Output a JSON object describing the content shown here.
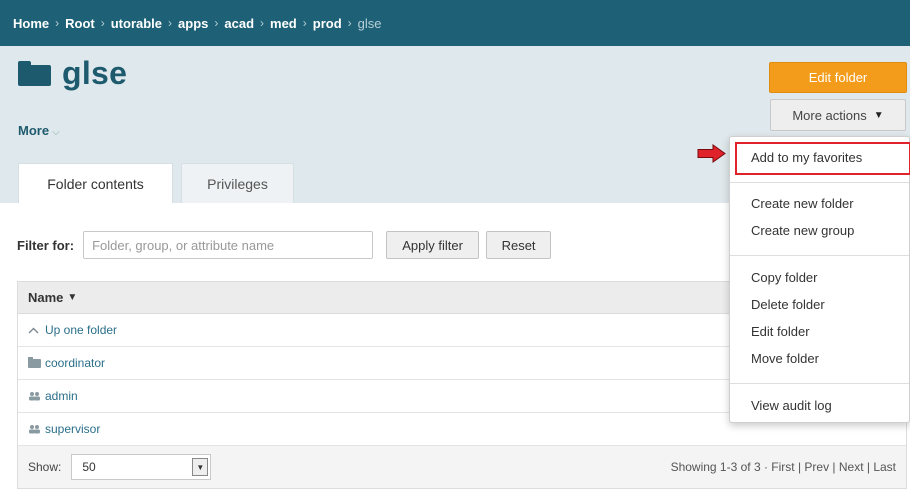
{
  "breadcrumb": {
    "items": [
      "Home",
      "Root",
      "utorable",
      "apps",
      "acad",
      "med",
      "prod"
    ],
    "current": "glse",
    "separator": "›"
  },
  "folder": {
    "title": "glse",
    "more_label": "More",
    "more_chevron": "⌵"
  },
  "actions": {
    "edit_folder": "Edit folder",
    "more_actions": "More actions",
    "more_caret": "▼"
  },
  "tabs": [
    {
      "label": "Folder contents",
      "active": true
    },
    {
      "label": "Privileges",
      "active": false
    }
  ],
  "filter": {
    "label": "Filter for:",
    "placeholder": "Folder, group, or attribute name",
    "apply": "Apply filter",
    "reset": "Reset"
  },
  "table": {
    "header": "Name",
    "sort_caret": "▼",
    "rows": [
      {
        "label": "Up one folder",
        "icon": "chevron-up-icon",
        "glyph": "^"
      },
      {
        "label": "coordinator",
        "icon": "folder-icon",
        "glyph": ""
      },
      {
        "label": "admin",
        "icon": "group-icon",
        "glyph": "👥"
      },
      {
        "label": "supervisor",
        "icon": "group-icon",
        "glyph": "👥"
      }
    ],
    "footer": {
      "show_label": "Show:",
      "page_size": "50",
      "paging": "Showing 1-3 of 3 · First | Prev | Next | Last"
    }
  },
  "menu": {
    "items": [
      "Add to my favorites",
      "Create new folder",
      "Create new group",
      "Copy folder",
      "Delete folder",
      "Edit folder",
      "Move folder",
      "View audit log"
    ]
  },
  "colors": {
    "breadcrumb_bg": "#1e6176",
    "header_bg": "#dfe8ec",
    "accent_orange": "#f39c1b",
    "highlight_red": "#e0222a",
    "link": "#2a6f8a"
  }
}
